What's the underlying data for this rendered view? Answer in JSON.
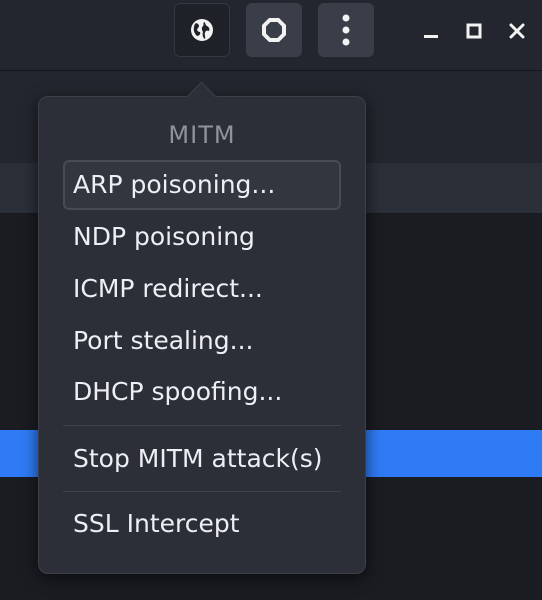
{
  "header": {
    "buttons": [
      {
        "icon": "globe-icon"
      },
      {
        "icon": "stop-icon"
      },
      {
        "icon": "kebab-menu-icon"
      }
    ],
    "window_controls": [
      "minimize-icon",
      "maximize-icon",
      "close-icon"
    ]
  },
  "menu": {
    "title": "MITM",
    "items": [
      {
        "label": "ARP poisoning..."
      },
      {
        "label": "NDP poisoning"
      },
      {
        "label": "ICMP redirect..."
      },
      {
        "label": "Port stealing..."
      },
      {
        "label": "DHCP spoofing..."
      },
      {
        "label": "Stop MITM attack(s)"
      },
      {
        "label": "SSL Intercept"
      }
    ]
  },
  "colors": {
    "accent": "#2f7bf5",
    "menu_bg": "#2c2f37",
    "text": "#eceff4",
    "title_text": "#8f939c"
  }
}
